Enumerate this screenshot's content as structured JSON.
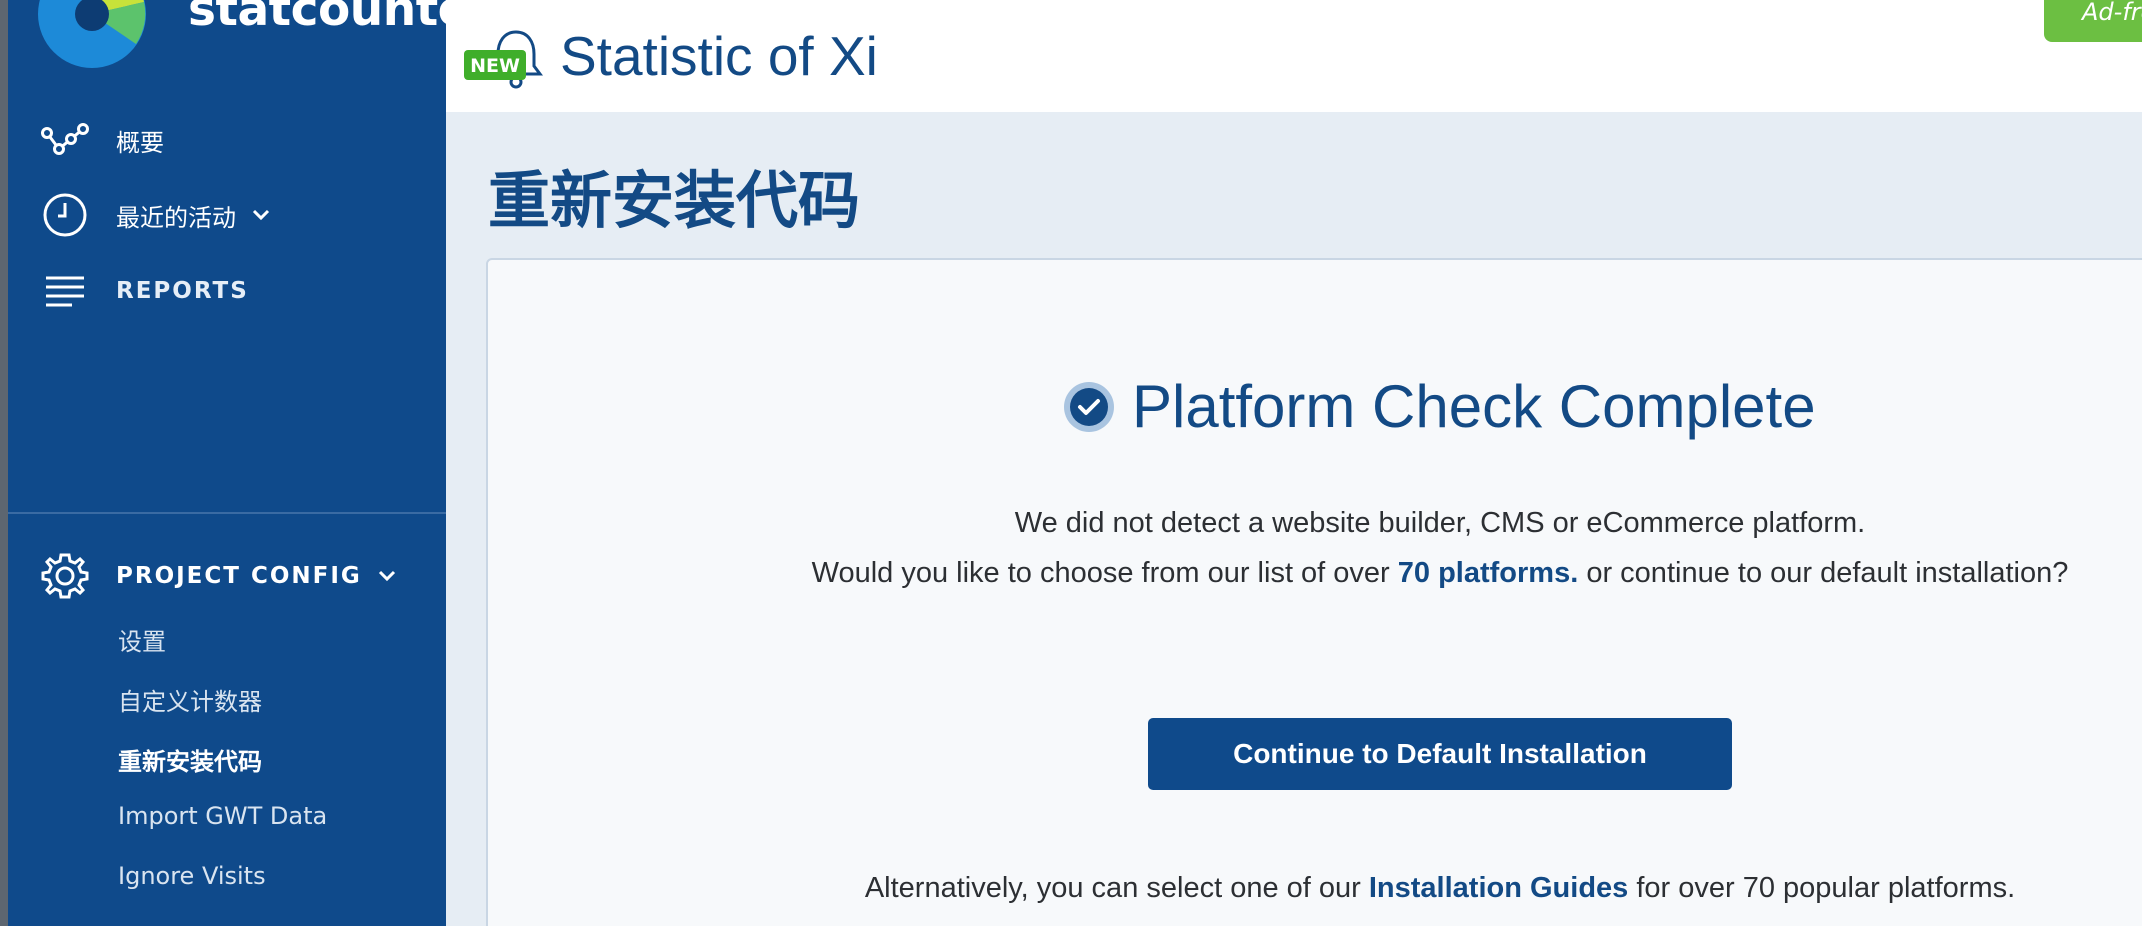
{
  "brand": {
    "name": "statcounter"
  },
  "sidebar": {
    "nav": [
      {
        "label": "概要",
        "icon": "overview-graph-icon"
      },
      {
        "label": "最近的活动",
        "icon": "clock-icon"
      },
      {
        "label": "REPORTS",
        "icon": "reports-list-icon"
      }
    ],
    "config": {
      "label": "PROJECT CONFIG",
      "icon": "gear-icon"
    },
    "config_items": [
      {
        "label": "设置"
      },
      {
        "label": "自定义计数器"
      },
      {
        "label": "重新安装代码",
        "active": true
      },
      {
        "label": "Import GWT Data"
      },
      {
        "label": "Ignore Visits"
      }
    ]
  },
  "header": {
    "badge": "NEW",
    "project_title": "Statistic of Xi",
    "adfree_label": "Ad-fre"
  },
  "main": {
    "page_title": "重新安装代码",
    "check_title": "Platform Check Complete",
    "line1": "We did not detect a website builder, CMS or eCommerce platform.",
    "line2_pre": "Would you like to choose from our list of over ",
    "line2_link": "70 platforms.",
    "line2_post": " or continue to our default installation?",
    "cta_label": "Continue to Default Installation",
    "alt_pre": "Alternatively, you can select one of our ",
    "alt_link": "Installation Guides",
    "alt_post": " for over 70 popular platforms."
  },
  "colors": {
    "sidebar_bg": "#0f4a8b",
    "accent_blue": "#134a85",
    "badge_green": "#3fae2a",
    "adfree_green": "#6cbf42"
  }
}
